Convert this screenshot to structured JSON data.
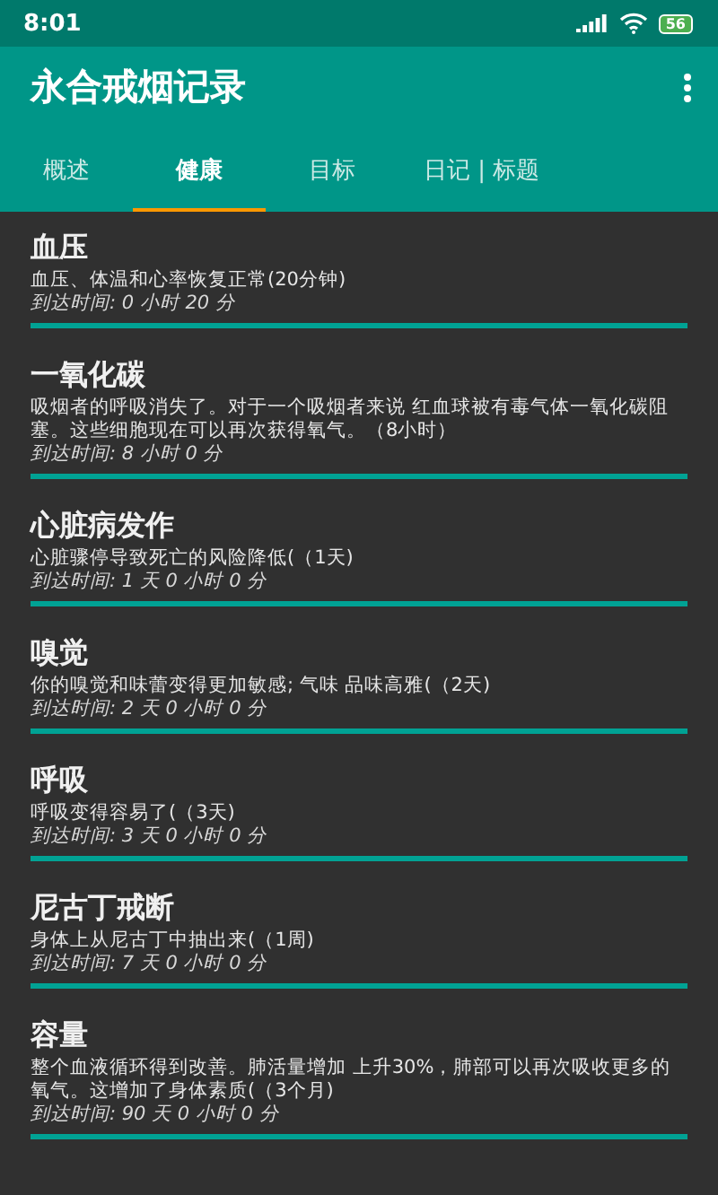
{
  "status_bar": {
    "time": "8:01",
    "battery": "56"
  },
  "app_bar": {
    "title": "永合戒烟记录"
  },
  "tabs": [
    {
      "label": "概述",
      "selected": false
    },
    {
      "label": "健康",
      "selected": true
    },
    {
      "label": "目标",
      "selected": false
    },
    {
      "label": "日记 | 标题",
      "selected": false
    }
  ],
  "milestones": [
    {
      "title": "血压",
      "description": "血压、体温和心率恢复正常(20分钟)",
      "reached": "到达时间:  0 小时 20 分",
      "level": 1
    },
    {
      "title": "一氧化碳",
      "description": "吸烟者的呼吸消失了。对于一个吸烟者来说 红血球被有毒气体一氧化碳阻塞。这些细胞现在可以再次获得氧气。（8小时）",
      "reached": "到达时间:  8 小时 0 分",
      "level": 1
    },
    {
      "title": "心脏病发作",
      "description": "心脏骤停导致死亡的风险降低(（1天)",
      "reached": "到达时间:  1 天 0 小时 0 分",
      "level": 1
    },
    {
      "title": "嗅觉",
      "description": "你的嗅觉和味蕾变得更加敏感; 气味 品味高雅(（2天)",
      "reached": "到达时间:  2 天 0 小时 0 分",
      "level": 1
    },
    {
      "title": "呼吸",
      "description": "呼吸变得容易了(（3天)",
      "reached": "到达时间:  3 天 0 小时 0 分",
      "level": 1
    },
    {
      "title": "尼古丁戒断",
      "description": "身体上从尼古丁中抽出来(（1周)",
      "reached": "到达时间:  7 天 0 小时 0 分",
      "level": 1
    },
    {
      "title": "容量",
      "description": "整个血液循环得到改善。肺活量增加 上升30%，肺部可以再次吸收更多的氧气。这增加了身体素质(（3个月)",
      "reached": "到达时间:  90 天 0 小时 0 分",
      "level": 1
    }
  ]
}
